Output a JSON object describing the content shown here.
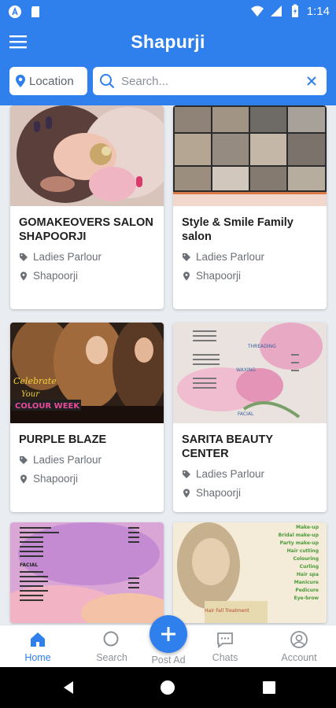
{
  "status_bar": {
    "time": "1:14"
  },
  "app": {
    "title": "Shapurji"
  },
  "location": {
    "label": "Location"
  },
  "search": {
    "placeholder": "Search..."
  },
  "listings": [
    {
      "name": "GOMAKEOVERS SALON SHAPOORJI",
      "category": "Ladies Parlour",
      "location": "Shapoorji"
    },
    {
      "name": "Style & Smile Family salon",
      "category": "Ladies Parlour",
      "location": "Shapoorji"
    },
    {
      "name": "PURPLE BLAZE",
      "category": "Ladies Parlour",
      "location": "Shapoorji"
    },
    {
      "name": "SARITA BEAUTY CENTER",
      "category": "Ladies Parlour",
      "location": "Shapoorji"
    },
    {
      "name": "",
      "category": "",
      "location": ""
    },
    {
      "name": "",
      "category": "",
      "location": ""
    }
  ],
  "images": {
    "purple_blaze": {
      "line1": "Celebrate",
      "line2": "Your",
      "line3": "COLOUR WEEK"
    },
    "sarita": {
      "line1": "THREADING",
      "line2": "WAXING",
      "line3": "FACIAL"
    },
    "tile5": {
      "line1": "FACIAL"
    },
    "tile6": {
      "line1": "Make-up",
      "line2": "Bridal make-up",
      "line3": "Party make-up",
      "line4": "Hair cutting",
      "line5": "Colouring",
      "line6": "Curling",
      "line7": "Hair spa",
      "line8": "Manicure",
      "line9": "Pedicure",
      "line10": "Eye-brow",
      "line11": "Hair Fall Treatment"
    }
  },
  "nav": {
    "home": "Home",
    "search": "Search",
    "post_ad": "Post Ad",
    "chats": "Chats",
    "account": "Account"
  },
  "colors": {
    "primary": "#2f80ed",
    "background": "#e9edf1"
  }
}
